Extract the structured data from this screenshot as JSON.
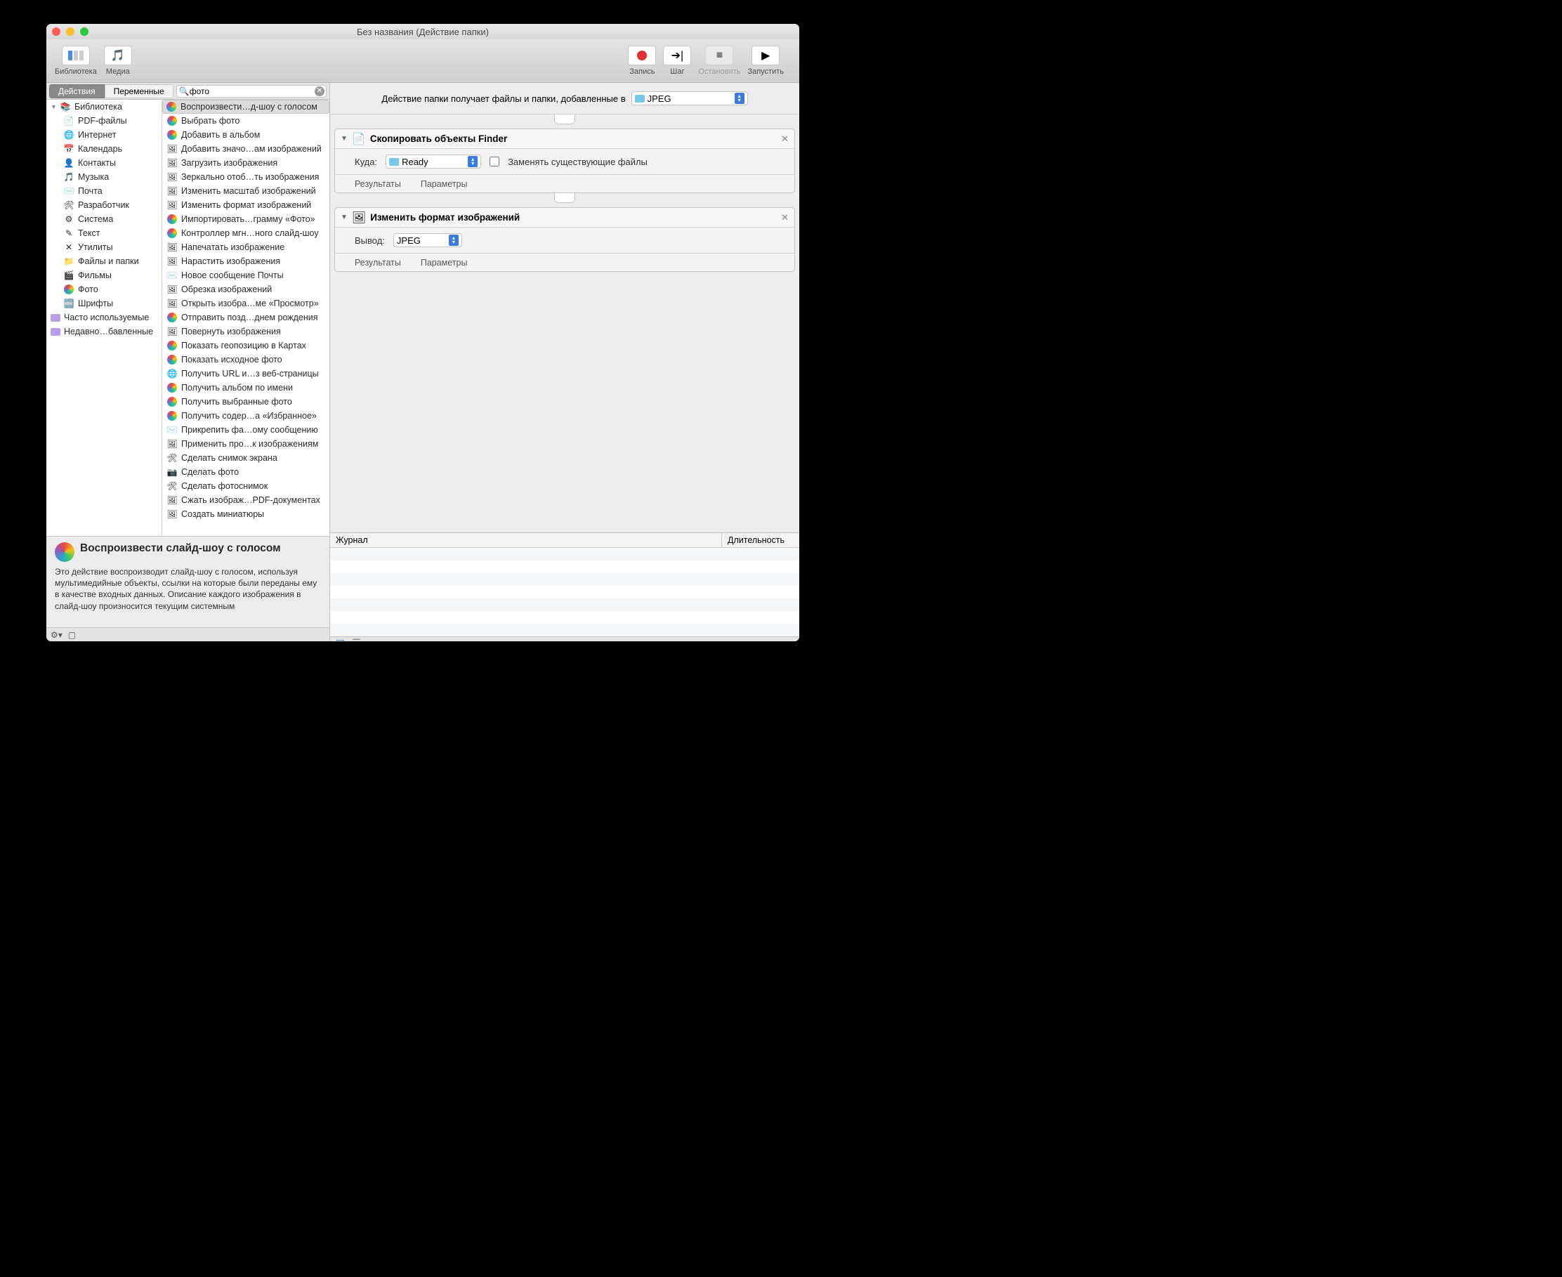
{
  "title": "Без названия (Действие папки)",
  "toolbar": {
    "library": "Библиотека",
    "media": "Медиа",
    "record": "Запись",
    "step": "Шаг",
    "stop": "Остановить",
    "run": "Запустить"
  },
  "tabs": {
    "actions": "Действия",
    "variables": "Переменные"
  },
  "search": {
    "value": "фото"
  },
  "libraryTree": [
    {
      "label": "Библиотека",
      "icon": "books",
      "expanded": true,
      "indent": 0
    },
    {
      "label": "PDF-файлы",
      "icon": "pdf",
      "indent": 1
    },
    {
      "label": "Интернет",
      "icon": "safari",
      "indent": 1
    },
    {
      "label": "Календарь",
      "icon": "calendar",
      "indent": 1
    },
    {
      "label": "Контакты",
      "icon": "contacts",
      "indent": 1
    },
    {
      "label": "Музыка",
      "icon": "music",
      "indent": 1
    },
    {
      "label": "Почта",
      "icon": "mail",
      "indent": 1
    },
    {
      "label": "Разработчик",
      "icon": "dev",
      "indent": 1
    },
    {
      "label": "Система",
      "icon": "system",
      "indent": 1
    },
    {
      "label": "Текст",
      "icon": "text",
      "indent": 1
    },
    {
      "label": "Утилиты",
      "icon": "util",
      "indent": 1
    },
    {
      "label": "Файлы и папки",
      "icon": "finder",
      "indent": 1
    },
    {
      "label": "Фильмы",
      "icon": "movies",
      "indent": 1
    },
    {
      "label": "Фото",
      "icon": "photos",
      "indent": 1
    },
    {
      "label": "Шрифты",
      "icon": "fonts",
      "indent": 1
    },
    {
      "label": "Часто используемые",
      "icon": "purple",
      "indent": 0
    },
    {
      "label": "Недавно…бавленные",
      "icon": "purple",
      "indent": 0
    }
  ],
  "actionList": [
    {
      "label": "Воспроизвести…д-шоу с голосом",
      "icon": "flower",
      "sel": true
    },
    {
      "label": "Выбрать фото",
      "icon": "flower"
    },
    {
      "label": "Добавить в альбом",
      "icon": "flower"
    },
    {
      "label": "Добавить значо…ам изображений",
      "icon": "preview"
    },
    {
      "label": "Загрузить изображения",
      "icon": "preview"
    },
    {
      "label": "Зеркально отоб…ть изображения",
      "icon": "preview"
    },
    {
      "label": "Изменить масштаб изображений",
      "icon": "preview"
    },
    {
      "label": "Изменить формат изображений",
      "icon": "preview"
    },
    {
      "label": "Импортировать…грамму «Фото»",
      "icon": "flower"
    },
    {
      "label": "Контроллер мгн…ного слайд-шоу",
      "icon": "flower"
    },
    {
      "label": "Напечатать изображение",
      "icon": "preview"
    },
    {
      "label": "Нарастить изображения",
      "icon": "preview"
    },
    {
      "label": "Новое сообщение Почты",
      "icon": "mail"
    },
    {
      "label": "Обрезка изображений",
      "icon": "preview"
    },
    {
      "label": "Открыть изобра…ме «Просмотр»",
      "icon": "preview"
    },
    {
      "label": "Отправить позд…днем рождения",
      "icon": "flower"
    },
    {
      "label": "Повернуть изображения",
      "icon": "preview"
    },
    {
      "label": "Показать геопозицию в Картах",
      "icon": "flower"
    },
    {
      "label": "Показать исходное фото",
      "icon": "flower"
    },
    {
      "label": "Получить URL и…з веб-страницы",
      "icon": "safari"
    },
    {
      "label": "Получить альбом по имени",
      "icon": "flower"
    },
    {
      "label": "Получить выбранные фото",
      "icon": "flower"
    },
    {
      "label": "Получить содер…а «Избранное»",
      "icon": "flower"
    },
    {
      "label": "Прикрепить фа…ому сообщению",
      "icon": "mail"
    },
    {
      "label": "Применить про…к изображениям",
      "icon": "preview"
    },
    {
      "label": "Сделать снимок экрана",
      "icon": "util"
    },
    {
      "label": "Сделать фото",
      "icon": "camera"
    },
    {
      "label": "Сделать фотоснимок",
      "icon": "util"
    },
    {
      "label": "Сжать изображ…PDF-документах",
      "icon": "preview"
    },
    {
      "label": "Создать миниатюры",
      "icon": "preview"
    }
  ],
  "description": {
    "title": "Воспроизвести слайд-шоу с голосом",
    "body": "Это действие воспроизводит слайд-шоу с голосом, используя мультимедийные объекты, ссылки на которые были переданы ему в качестве входных данных. Описание каждого изображения в слайд-шоу произносится текущим системным"
  },
  "flowHeader": {
    "text": "Действие папки получает файлы и папки, добавленные в",
    "folder": "JPEG"
  },
  "actions": [
    {
      "title": "Скопировать объекты Finder",
      "fields": {
        "destLabel": "Куда:",
        "destValue": "Ready",
        "replaceLabel": "Заменять существующие файлы",
        "replaceChecked": false
      },
      "footer": {
        "results": "Результаты",
        "options": "Параметры"
      }
    },
    {
      "title": "Изменить формат изображений",
      "fields": {
        "outputLabel": "Вывод:",
        "outputValue": "JPEG"
      },
      "footer": {
        "results": "Результаты",
        "options": "Параметры"
      }
    }
  ],
  "log": {
    "col1": "Журнал",
    "col2": "Длительность"
  }
}
